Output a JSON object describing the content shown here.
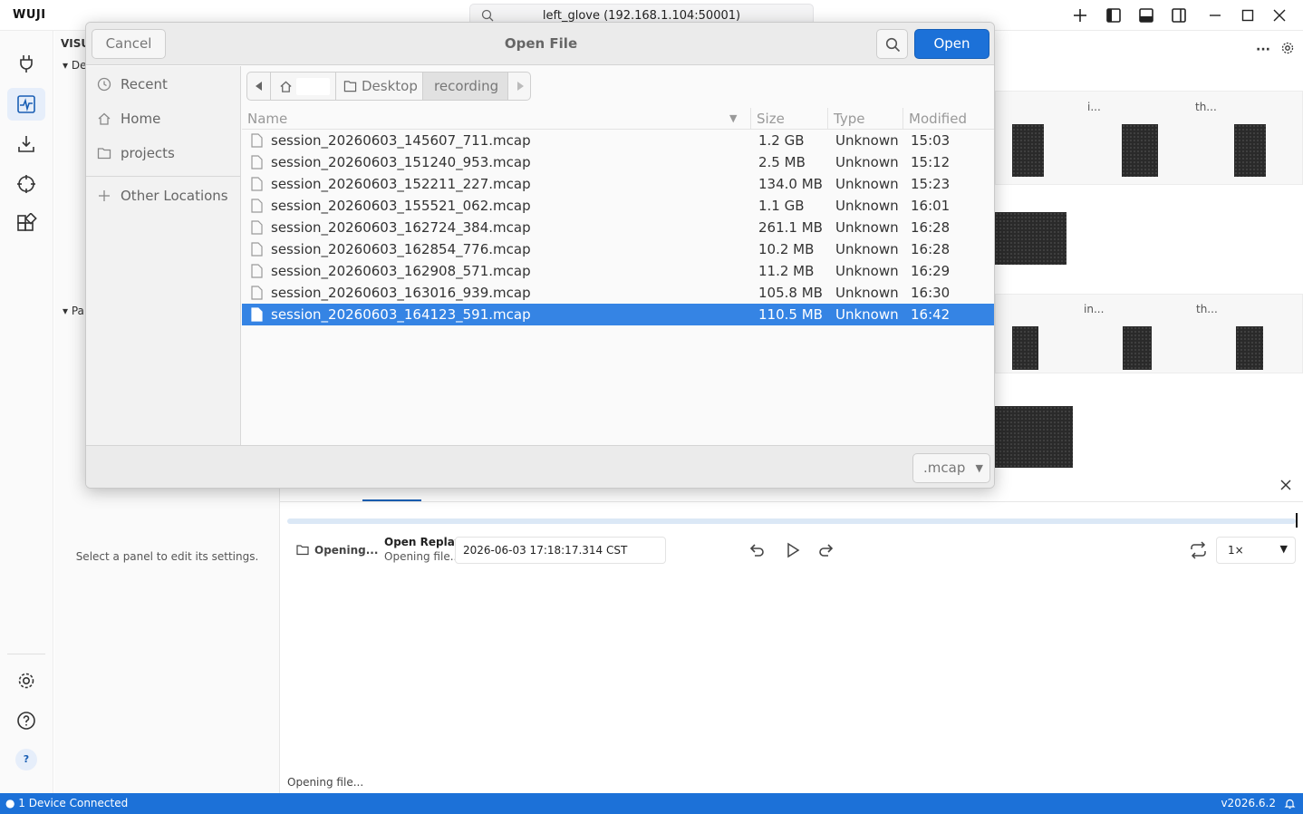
{
  "app": {
    "brand": "WUJI",
    "device_search": "left_glove (192.168.1.104:50001)"
  },
  "side_panel": {
    "header_visual": "VISU",
    "section_de": "De",
    "section_pa": "Pa",
    "hint": "Select a panel to edit its settings."
  },
  "panels": {
    "label_i": "i...",
    "label_th": "th...",
    "label_in": "in...",
    "label_th2": "th..."
  },
  "playback": {
    "opening_label": "Opening...",
    "title": "Open Replay",
    "subtitle": "Opening file...",
    "timestamp": "2026-06-03 17:18:17.314 CST",
    "speed": "1×",
    "status": "Opening file..."
  },
  "statusbar": {
    "devices": "1 Device Connected",
    "version": "v2026.6.2"
  },
  "dialog": {
    "title": "Open File",
    "cancel_label": "Cancel",
    "open_label": "Open",
    "places": [
      {
        "label": "Recent",
        "icon": "clock-icon"
      },
      {
        "label": "Home",
        "icon": "home-icon"
      },
      {
        "label": "projects",
        "icon": "folder-icon"
      }
    ],
    "other_locations": "Other Locations",
    "path": [
      "Desktop",
      "recording"
    ],
    "columns": {
      "name": "Name",
      "size": "Size",
      "type": "Type",
      "modified": "Modified"
    },
    "files": [
      {
        "name": "session_20260603_145607_711.mcap",
        "size": "1.2 GB",
        "type": "Unknown",
        "modified": "15:03"
      },
      {
        "name": "session_20260603_151240_953.mcap",
        "size": "2.5 MB",
        "type": "Unknown",
        "modified": "15:12"
      },
      {
        "name": "session_20260603_152211_227.mcap",
        "size": "134.0 MB",
        "type": "Unknown",
        "modified": "15:23"
      },
      {
        "name": "session_20260603_155521_062.mcap",
        "size": "1.1 GB",
        "type": "Unknown",
        "modified": "16:01"
      },
      {
        "name": "session_20260603_162724_384.mcap",
        "size": "261.1 MB",
        "type": "Unknown",
        "modified": "16:28"
      },
      {
        "name": "session_20260603_162854_776.mcap",
        "size": "10.2 MB",
        "type": "Unknown",
        "modified": "16:28"
      },
      {
        "name": "session_20260603_162908_571.mcap",
        "size": "11.2 MB",
        "type": "Unknown",
        "modified": "16:29"
      },
      {
        "name": "session_20260603_163016_939.mcap",
        "size": "105.8 MB",
        "type": "Unknown",
        "modified": "16:30"
      },
      {
        "name": "session_20260603_164123_591.mcap",
        "size": "110.5 MB",
        "type": "Unknown",
        "modified": "16:42",
        "selected": true
      }
    ],
    "filter": ".mcap"
  },
  "colors": {
    "accent": "#1c71d8",
    "selection": "#3584e4",
    "statusbar": "#1c71d8"
  }
}
